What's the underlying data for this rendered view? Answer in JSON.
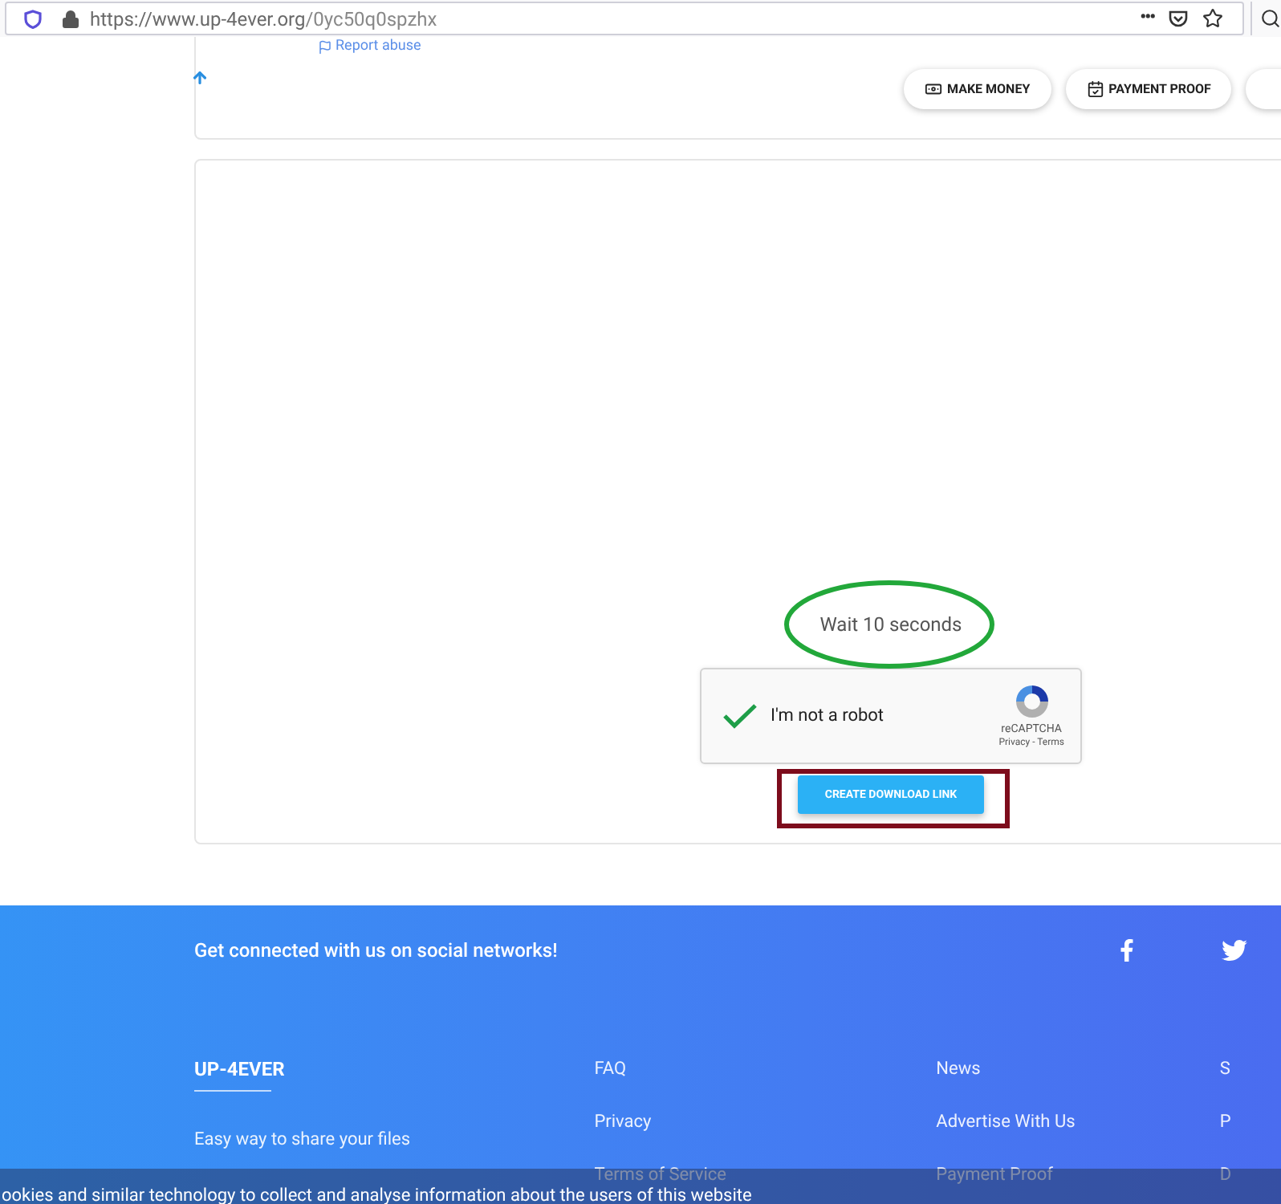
{
  "address_bar": {
    "url_host": "https://www.up-4ever.org",
    "url_path": "/0yc50q0spzhx",
    "more": "•••"
  },
  "top_card": {
    "report_link": "Report abuse",
    "nav_buttons": [
      {
        "label": "MAKE MONEY"
      },
      {
        "label": "PAYMENT PROOF"
      }
    ]
  },
  "download_card": {
    "timer": "Wait 10 seconds",
    "captcha": {
      "label": "I'm not a robot",
      "checked": true,
      "brand": "reCAPTCHA",
      "privacy": "Privacy",
      "separator": "-",
      "terms": "Terms"
    },
    "button": "CREATE DOWNLOAD LINK"
  },
  "footer": {
    "social_heading": "Get connected with us on social networks!",
    "brand": "UP-4EVER",
    "tagline": "Easy way to share your files",
    "columns": [
      [
        "FAQ",
        "Privacy",
        "Terms of Service"
      ],
      [
        "News",
        "Advertise With Us",
        "Payment Proof"
      ],
      [
        "S",
        "P",
        "D"
      ]
    ]
  },
  "cookie_bar": {
    "text": "ookies and similar technology to collect and analyse information about the users of this website"
  }
}
